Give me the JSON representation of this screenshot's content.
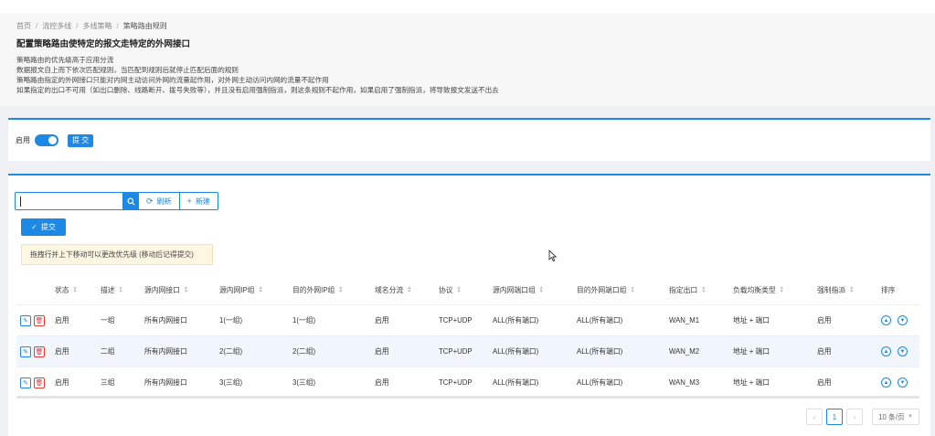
{
  "breadcrumb": [
    "首页",
    "流控多线",
    "多线策略",
    "策略路由规则"
  ],
  "breadcrumb_separator": "/",
  "page_title": "配置策略路由使特定的报文走特定的外网接口",
  "description": [
    "策略路由的优先级高于应用分流",
    "数据报文自上而下依次匹配规则，当匹配到规则后就停止匹配后面的规则",
    "策略路由指定的外网接口只能对内网主动访问外网的流量起作用，对外网主动访问内网的流量不起作用",
    "如果指定的出口不可用（如出口删除、线路断开、拨号失败等），并且没有启用强制指派，则这条规则不起作用，如果启用了强制指派，将导致报文发送不出去"
  ],
  "enable_card": {
    "label": "启用",
    "enabled": true,
    "submit_label": "提 交"
  },
  "toolbar": {
    "search_value": "",
    "refresh_label": "刷新",
    "new_label": "新建"
  },
  "submit_label": "提交",
  "hint": "拖拽行并上下移动可以更改优先级 (移动后记得提交)",
  "table": {
    "headers": {
      "status": "状态",
      "desc": "描述",
      "lan_iface": "源内网接口",
      "lan_ip": "源内网IP组",
      "dst_ip": "目的外网IP组",
      "domain": "域名分流",
      "protocol": "协议",
      "lan_port": "源内网端口组",
      "dst_port": "目的外网端口组",
      "out": "指定出口",
      "lb": "负载均衡类型",
      "force": "强制指派",
      "order": "排序"
    },
    "rows": [
      {
        "status": "启用",
        "desc": "一组",
        "lan_iface": "所有内网接口",
        "lan_ip": "1(一组)",
        "dst_ip": "1(一组)",
        "domain": "启用",
        "protocol": "TCP+UDP",
        "lan_port": "ALL(所有端口)",
        "dst_port": "ALL(所有端口)",
        "out": "WAN_M1",
        "lb": "地址 + 端口",
        "force": "启用"
      },
      {
        "status": "启用",
        "desc": "二组",
        "lan_iface": "所有内网接口",
        "lan_ip": "2(二组)",
        "dst_ip": "2(二组)",
        "domain": "启用",
        "protocol": "TCP+UDP",
        "lan_port": "ALL(所有端口)",
        "dst_port": "ALL(所有端口)",
        "out": "WAN_M2",
        "lb": "地址 + 端口",
        "force": "启用"
      },
      {
        "status": "启用",
        "desc": "三组",
        "lan_iface": "所有内网接口",
        "lan_ip": "3(三组)",
        "dst_ip": "3(三组)",
        "domain": "启用",
        "protocol": "TCP+UDP",
        "lan_port": "ALL(所有端口)",
        "dst_port": "ALL(所有端口)",
        "out": "WAN_M3",
        "lb": "地址 + 端口",
        "force": "启用"
      }
    ]
  },
  "pagination": {
    "current_page": "1",
    "page_size": "10 条/页"
  },
  "icons": [
    "search-icon",
    "refresh-icon",
    "plus-icon",
    "check-icon",
    "edit-icon",
    "delete-icon",
    "arrow-up-icon",
    "arrow-down-icon",
    "chevron-left-icon",
    "chevron-right-icon",
    "chevron-down-icon"
  ],
  "colors": {
    "accent": "#1e88e5",
    "danger": "#e53935",
    "hint_bg": "#fdf6e3"
  }
}
